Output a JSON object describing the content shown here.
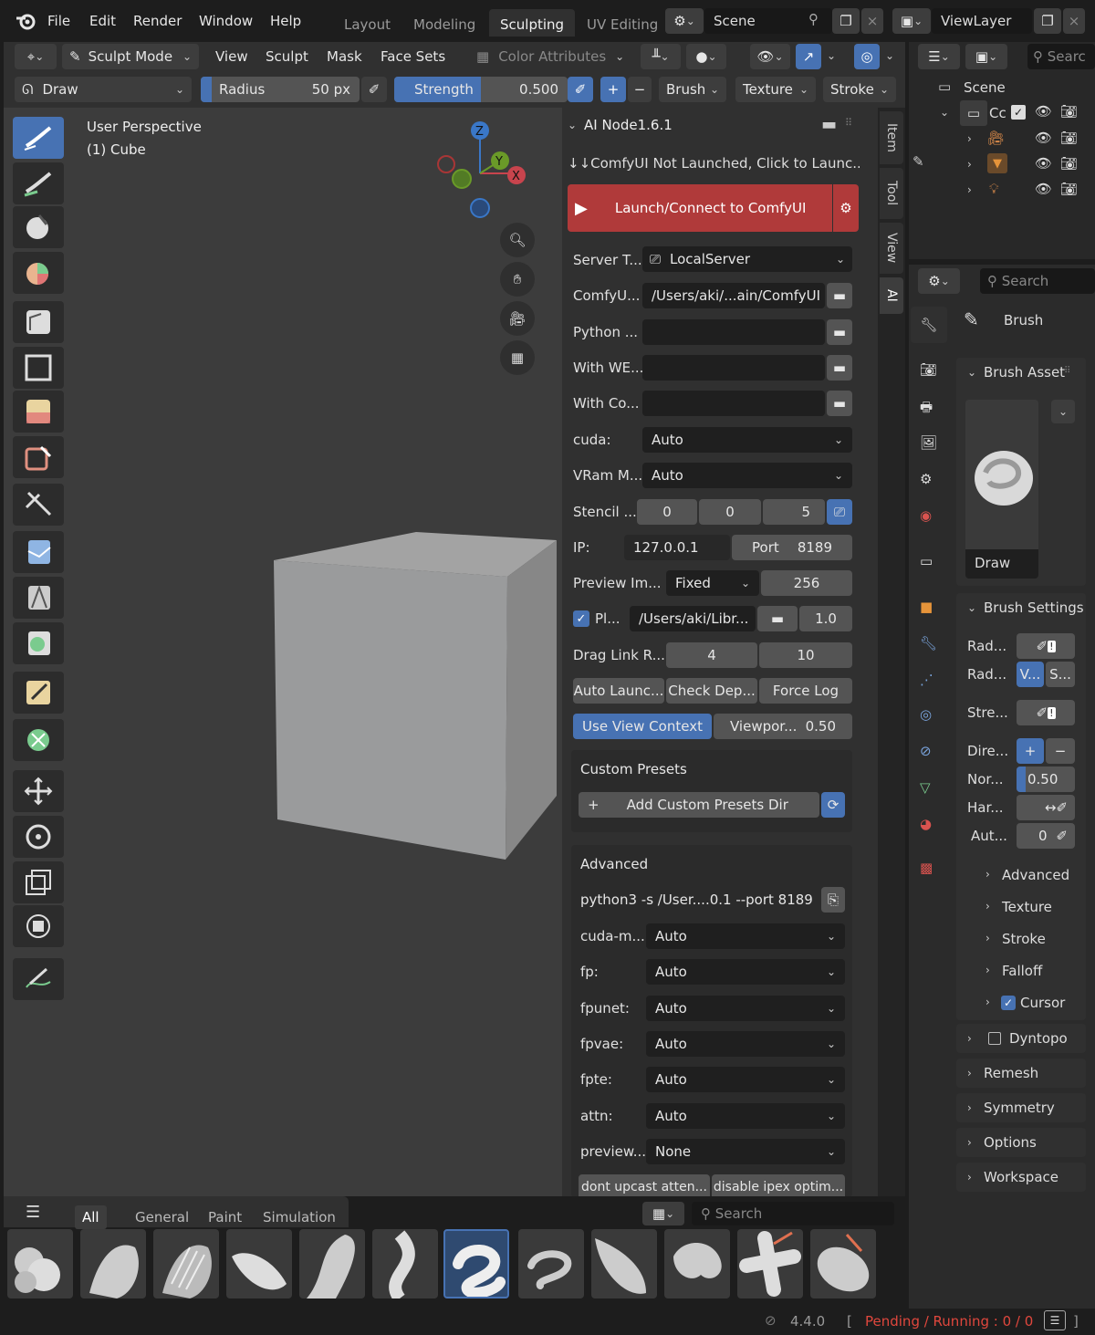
{
  "menu": {
    "file": "File",
    "edit": "Edit",
    "render": "Render",
    "window": "Window",
    "help": "Help"
  },
  "workspaces": [
    "Layout",
    "Modeling",
    "Sculpting",
    "UV Editing"
  ],
  "scene": {
    "label": "Scene",
    "viewlayer": "ViewLayer"
  },
  "header": {
    "mode": "Sculpt Mode",
    "view": "View",
    "sculpt": "Sculpt",
    "mask": "Mask",
    "face_sets": "Face Sets",
    "color_attr": "Color Attributes",
    "brush_name": "Draw",
    "radius_label": "Radius",
    "radius_value": "50 px",
    "strength_label": "Strength",
    "strength_value": "0.500",
    "brush_menu": "Brush",
    "texture_menu": "Texture",
    "stroke_menu": "Stroke",
    "plus": "+",
    "minus": "−"
  },
  "viewport": {
    "perspective": "User Perspective",
    "object": "(1) Cube",
    "axis_z": "Z",
    "axis_y": "Y",
    "axis_x": "X"
  },
  "ai_panel": {
    "title": "AI Node1.6.1",
    "status": "↓↓ComfyUI Not Launched, Click to Launc...",
    "launch": "Launch/Connect to ComfyUI",
    "rows": {
      "server_type": {
        "label": "Server T...",
        "value": "LocalServer"
      },
      "comfy_path": {
        "label": "ComfyU...",
        "value": "/Users/aki/...ain/ComfyUI"
      },
      "python": {
        "label": "Python ...",
        "value": ""
      },
      "with_we": {
        "label": "With WE...",
        "value": ""
      },
      "with_co": {
        "label": "With Co...",
        "value": ""
      },
      "cuda": {
        "label": "cuda:",
        "value": "Auto"
      },
      "vram": {
        "label": "VRam M...",
        "value": "Auto"
      },
      "stencil": {
        "label": "Stencil ...",
        "v1": "0",
        "v2": "0",
        "v3": "5"
      },
      "ip": {
        "label": "IP:",
        "value": "127.0.0.1",
        "port_label": "Port",
        "port_value": "8189"
      },
      "preview": {
        "label": "Preview Im...",
        "mode": "Fixed",
        "value": "256"
      },
      "pl": {
        "label": "Pl...",
        "path": "/Users/aki/Libr...",
        "value": "1.0"
      },
      "drag": {
        "label": "Drag Link R...",
        "v1": "4",
        "v2": "10"
      }
    },
    "buttons": {
      "auto_launch": "Auto Launc...",
      "check_dep": "Check Dep...",
      "force_log": "Force Log",
      "use_view": "Use View Context",
      "viewport_label": "Viewpor...",
      "viewport_value": "0.50"
    },
    "custom_presets": {
      "title": "Custom Presets",
      "add": "Add Custom Presets Dir"
    },
    "advanced": {
      "title": "Advanced",
      "cmd": "python3 -s /User....0.1 --port 8189",
      "rows": [
        {
          "label": "cuda-m...",
          "value": "Auto"
        },
        {
          "label": "fp:",
          "value": "Auto"
        },
        {
          "label": "fpunet:",
          "value": "Auto"
        },
        {
          "label": "fpvae:",
          "value": "Auto"
        },
        {
          "label": "fpte:",
          "value": "Auto"
        },
        {
          "label": "attn:",
          "value": "Auto"
        },
        {
          "label": "preview...",
          "value": "None"
        }
      ],
      "btn1": "dont upcast atten...",
      "btn2": "disable ipex optim..."
    }
  },
  "side_tabs": [
    "Item",
    "Tool",
    "View",
    "AI"
  ],
  "outliner": {
    "search": "Searc",
    "scene": "Scene",
    "collection": "Cc"
  },
  "properties": {
    "search": "Search",
    "brush_title": "Brush",
    "brush_asset": "Brush Asset",
    "draw": "Draw",
    "brush_settings": "Brush Settings",
    "rad1": "Rad...",
    "rad2": "Rad...",
    "rad2_v": "V...",
    "rad2_s": "S...",
    "stre": "Stre...",
    "dire": "Dire...",
    "nor": "Nor...",
    "nor_value": "0.50",
    "har": "Har...",
    "aut": "Aut...",
    "aut_value": "0",
    "subs": [
      "Advanced",
      "Texture",
      "Stroke",
      "Falloff",
      "Cursor"
    ],
    "panels": [
      "Dyntopo",
      "Remesh",
      "Symmetry",
      "Options",
      "Workspace"
    ]
  },
  "assets": {
    "tabs": [
      "All",
      "General",
      "Paint",
      "Simulation"
    ],
    "search": "Search"
  },
  "status": {
    "version": "4.4.0",
    "bracket_open": "[",
    "pending": "Pending / Running : 0 / 0",
    "bracket_close": "]"
  },
  "colors": {
    "accent": "#4772b3",
    "launch": "#b03a3a",
    "pending": "#e0473d"
  }
}
